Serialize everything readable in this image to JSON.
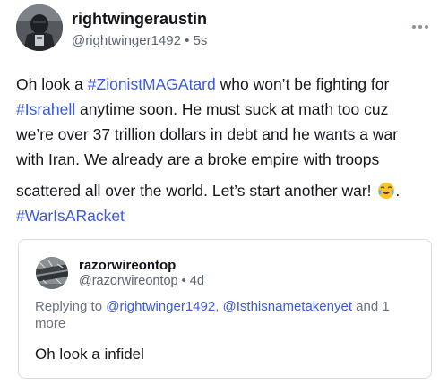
{
  "post": {
    "author_name": "rightwingeraustin",
    "handle": "@rightwinger1492",
    "separator": "•",
    "time": "5s",
    "more_icon": "more-horizontal-icon",
    "lines": [
      [
        {
          "t": "Oh look a ",
          "tag": false
        },
        {
          "t": "#ZionistMAGAtard",
          "tag": true
        },
        {
          "t": " who won’t be fighting for",
          "tag": false
        }
      ],
      [
        {
          "t": "#Israhell",
          "tag": true
        },
        {
          "t": " anytime soon. He must suck at math too cuz",
          "tag": false
        }
      ],
      [
        {
          "t": "we’re over 37 trillion dollars in debt and he wants a war",
          "tag": false
        }
      ],
      [
        {
          "t": "with Iran. We already are a broke empire with troops",
          "tag": false
        }
      ],
      [
        {
          "t": "scattered all over the world. Let’s start another war!",
          "tag": false
        }
      ],
      [
        {
          "t": "#WarIsARacket",
          "tag": true
        }
      ]
    ],
    "emoji": "face-with-tears-of-joy-icon",
    "after_emoji": "."
  },
  "quote": {
    "author_name": "razorwireontop",
    "handle": "@razorwireontop",
    "separator": "•",
    "time": "4d",
    "reply_prefix": "Replying to ",
    "mentions": [
      "@rightwinger1492",
      "@Isthisnametakenyet"
    ],
    "reply_joiner": ", ",
    "reply_suffix": " and 1 more",
    "text": "Oh look a infidel"
  },
  "colors": {
    "hashtag": "#3b5bdb",
    "muted": "#5b6470",
    "border": "#d9dde2"
  }
}
